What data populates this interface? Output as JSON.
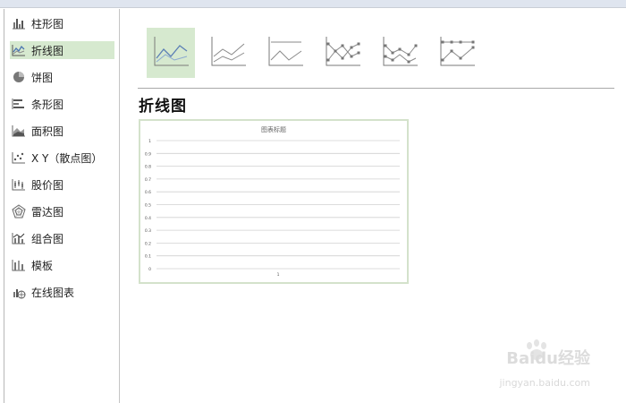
{
  "sidebar": {
    "items": [
      {
        "label": "柱形图",
        "icon": "column-chart-icon",
        "active": false
      },
      {
        "label": "折线图",
        "icon": "line-chart-icon",
        "active": true
      },
      {
        "label": "饼图",
        "icon": "pie-chart-icon",
        "active": false
      },
      {
        "label": "条形图",
        "icon": "bar-chart-icon",
        "active": false
      },
      {
        "label": "面积图",
        "icon": "area-chart-icon",
        "active": false
      },
      {
        "label": "X Y（散点图）",
        "icon": "scatter-chart-icon",
        "active": false
      },
      {
        "label": "股价图",
        "icon": "stock-chart-icon",
        "active": false
      },
      {
        "label": "雷达图",
        "icon": "radar-chart-icon",
        "active": false
      },
      {
        "label": "组合图",
        "icon": "combo-chart-icon",
        "active": false
      },
      {
        "label": "模板",
        "icon": "template-icon",
        "active": false
      },
      {
        "label": "在线图表",
        "icon": "online-chart-icon",
        "active": false
      }
    ]
  },
  "subtypes": [
    {
      "icon": "line-subtype-icon",
      "active": true
    },
    {
      "icon": "stacked-line-subtype-icon",
      "active": false
    },
    {
      "icon": "percent-stacked-line-subtype-icon",
      "active": false
    },
    {
      "icon": "line-markers-subtype-icon",
      "active": false
    },
    {
      "icon": "stacked-line-markers-subtype-icon",
      "active": false
    },
    {
      "icon": "percent-stacked-line-markers-subtype-icon",
      "active": false
    }
  ],
  "section_title": "折线图",
  "colors": {
    "accent": "#d6e9cf",
    "line": "#5b7fb5",
    "gray": "#8a8a8a"
  },
  "chart_data": {
    "type": "line",
    "title": "图表标题",
    "categories": [
      "1"
    ],
    "series": [],
    "y_ticks": [
      "1",
      "0.9",
      "0.8",
      "0.7",
      "0.6",
      "0.5",
      "0.4",
      "0.3",
      "0.2",
      "0.1",
      "0"
    ],
    "ylim": [
      0,
      1
    ],
    "grid": true
  },
  "watermark": {
    "brand": "Baidu经验",
    "url": "jingyan.baidu.com"
  }
}
